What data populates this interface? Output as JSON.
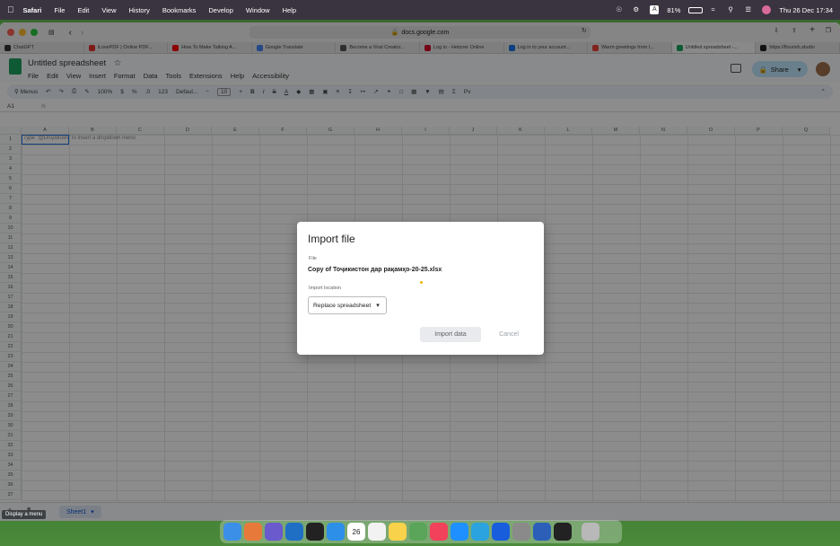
{
  "menubar": {
    "app": "Safari",
    "items": [
      "File",
      "Edit",
      "View",
      "History",
      "Bookmarks",
      "Develop",
      "Window",
      "Help"
    ],
    "battery": "81%",
    "datetime": "Thu 26 Dec  17:34"
  },
  "browser": {
    "url": "docs.google.com",
    "tabs": [
      {
        "title": "ChatGPT",
        "color": "#333333"
      },
      {
        "title": "iLovePDF | Online PDF...",
        "color": "#e5322d"
      },
      {
        "title": "How To Make Talking A...",
        "color": "#ff0000"
      },
      {
        "title": "Google Translate",
        "color": "#4285f4"
      },
      {
        "title": "Become a Viral Creator...",
        "color": "#555555"
      },
      {
        "title": "Log in - Hetzner Online",
        "color": "#d50c2d"
      },
      {
        "title": "Log in to your account...",
        "color": "#1a73e8"
      },
      {
        "title": "Warm greetings from I...",
        "color": "#ea4335"
      },
      {
        "title": "Untitled spreadsheet -...",
        "color": "#1ea362"
      },
      {
        "title": "https://flourish.studio",
        "color": "#222222"
      }
    ]
  },
  "sheets": {
    "doc_title": "Untitled spreadsheet",
    "menus": [
      "File",
      "Edit",
      "View",
      "Insert",
      "Format",
      "Data",
      "Tools",
      "Extensions",
      "Help",
      "Accessibility"
    ],
    "share_label": "Share",
    "toolbar": {
      "menus": "Menus",
      "zoom": "100%",
      "currency": "$",
      "percent": "%",
      "decimals": ".0",
      "format123": "123",
      "font": "Defaul...",
      "font_size": "10"
    },
    "cell_ref": "A1",
    "fx": "fx",
    "columns": [
      "A",
      "B",
      "C",
      "D",
      "E",
      "F",
      "G",
      "H",
      "I",
      "J",
      "K",
      "L",
      "M",
      "N",
      "O",
      "P",
      "Q"
    ],
    "rows": [
      "1",
      "2",
      "3",
      "4",
      "5",
      "6",
      "7",
      "8",
      "9",
      "10",
      "11",
      "12",
      "13",
      "14",
      "15",
      "16",
      "17",
      "18",
      "19",
      "20",
      "21",
      "22",
      "23",
      "24",
      "25",
      "26",
      "27",
      "28",
      "29",
      "30",
      "31",
      "32",
      "33",
      "34",
      "35",
      "36",
      "37"
    ],
    "a1_hint": "Type \"@Dropdown\" to insert a dropdown menu",
    "sheet_tab": "Sheet1",
    "tooltip": "Display a menu"
  },
  "dialog": {
    "title": "Import file",
    "file_label": "File",
    "file_name": "Copy of Тоҷикистон дар рақамҳо-20-25.xlsx",
    "location_label": "Import location",
    "location_value": "Replace spreadsheet",
    "import_button": "Import data",
    "cancel_button": "Cancel"
  },
  "dock": {
    "apps": [
      {
        "name": "finder-icon",
        "color": "#3b8fe6"
      },
      {
        "name": "launchpad-icon",
        "color": "#e7793a"
      },
      {
        "name": "layers-icon",
        "color": "#6a5acd"
      },
      {
        "name": "vscode-icon",
        "color": "#1f6fc5"
      },
      {
        "name": "chatgpt-icon",
        "color": "#222222"
      },
      {
        "name": "safari-icon",
        "color": "#2e8fe8"
      },
      {
        "name": "calendar-icon",
        "color": "#ffffff"
      },
      {
        "name": "reminders-icon",
        "color": "#f2f2f2"
      },
      {
        "name": "notes-icon",
        "color": "#f7d24a"
      },
      {
        "name": "preview-icon",
        "color": "#5aa55a"
      },
      {
        "name": "music-icon",
        "color": "#f2415a"
      },
      {
        "name": "appstore-icon",
        "color": "#1e90ff"
      },
      {
        "name": "telegram-icon",
        "color": "#2aa3de"
      },
      {
        "name": "bitwarden-icon",
        "color": "#175ddc"
      },
      {
        "name": "settings-icon",
        "color": "#8a8a8a"
      },
      {
        "name": "word-icon",
        "color": "#2b5fb8"
      },
      {
        "name": "terminal-icon",
        "color": "#222222"
      },
      {
        "name": "trash-icon",
        "color": "#b8b8b8"
      }
    ],
    "calendar_day": "26"
  }
}
